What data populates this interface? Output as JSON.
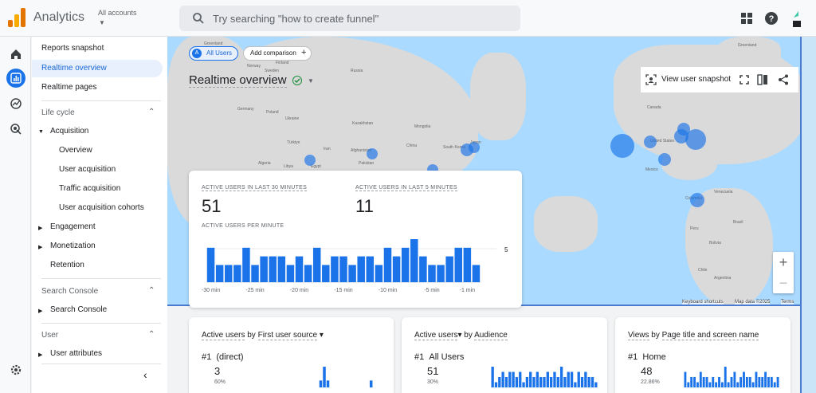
{
  "app": {
    "title": "Analytics",
    "account_label": "All accounts"
  },
  "search": {
    "placeholder": "Try searching \"how to create funnel\""
  },
  "nav": {
    "reports_snapshot": "Reports snapshot",
    "realtime_overview": "Realtime overview",
    "realtime_pages": "Realtime pages",
    "lifecycle": "Life cycle",
    "acquisition": "Acquisition",
    "overview": "Overview",
    "user_acquisition": "User acquisition",
    "traffic_acquisition": "Traffic acquisition",
    "user_acquisition_cohorts": "User acquisition cohorts",
    "engagement": "Engagement",
    "monetization": "Monetization",
    "retention": "Retention",
    "search_console_section": "Search Console",
    "search_console_item": "Search Console",
    "user_section": "User",
    "user_attributes": "User attributes"
  },
  "comparison": {
    "segment_badge": "A",
    "segment": "All Users",
    "add": "Add comparison",
    "plus": "+"
  },
  "page": {
    "title": "Realtime overview",
    "view_user_snapshot": "View user snapshot"
  },
  "map": {
    "labels": [
      "Greenland",
      "Norway",
      "Sweden",
      "Finland",
      "Russia",
      "Germany",
      "Poland",
      "Ukraine",
      "Kazakhstan",
      "Mongolia",
      "Türkiye",
      "Iran",
      "Afghanistan",
      "China",
      "South Korea",
      "Japan",
      "Algeria",
      "Libya",
      "Egypt",
      "Pakistan",
      "Canada",
      "United States",
      "Mexico",
      "Colombia",
      "Peru",
      "Brazil",
      "Bolivia",
      "Chile",
      "Argentina",
      "Venezuela",
      "Greenland"
    ],
    "footer_shortcuts": "Keyboard shortcuts",
    "footer_data": "Map data ©2025",
    "footer_terms": "Terms",
    "zoom_in": "+",
    "zoom_out": "−"
  },
  "realtime_card": {
    "active_30_label": "ACTIVE USERS IN LAST 30 MINUTES",
    "active_30_value": "51",
    "active_5_label": "ACTIVE USERS IN LAST 5 MINUTES",
    "active_5_value": "11",
    "per_minute_label": "ACTIVE USERS PER MINUTE"
  },
  "chart_data": {
    "type": "bar",
    "title": "ACTIVE USERS PER MINUTE",
    "values": [
      4,
      2,
      2,
      2,
      4,
      2,
      3,
      3,
      3,
      2,
      3,
      2,
      4,
      2,
      3,
      3,
      2,
      3,
      3,
      2,
      4,
      3,
      4,
      5,
      3,
      2,
      2,
      3,
      4,
      4,
      2
    ],
    "ylim": [
      0,
      5
    ],
    "y_tick": "5",
    "x_tick_labels": [
      "-30 min",
      "-25 min",
      "-20 min",
      "-15 min",
      "-10 min",
      "-5 min",
      "-1 min"
    ]
  },
  "cards": [
    {
      "title_metric": "Active users",
      "title_by": " by ",
      "title_dim": "First user source",
      "rank": "#1",
      "name": "(direct)",
      "value": "3",
      "pct": "60%",
      "spark": [
        0,
        0,
        0,
        0,
        0,
        0,
        0,
        0,
        0,
        0,
        0,
        0,
        0,
        0,
        1,
        3,
        1,
        0,
        0,
        0,
        0,
        0,
        0,
        0,
        0,
        0,
        0,
        0,
        1,
        0,
        0
      ]
    },
    {
      "title_metric": "Active users",
      "title_by": " by ",
      "title_dim": "Audience",
      "rank": "#1",
      "name": "All Users",
      "value": "51",
      "pct": "30%",
      "spark": [
        4,
        1,
        2,
        3,
        2,
        3,
        3,
        2,
        3,
        1,
        2,
        3,
        2,
        3,
        2,
        2,
        3,
        2,
        3,
        2,
        4,
        2,
        3,
        3,
        1,
        3,
        2,
        3,
        2,
        2,
        1
      ]
    },
    {
      "title_metric": "Views",
      "title_by": " by ",
      "title_dim": "Page title and screen name",
      "rank": "#1",
      "name": "Home",
      "value": "48",
      "pct": "22.86%",
      "spark": [
        3,
        1,
        2,
        2,
        1,
        3,
        2,
        2,
        1,
        2,
        1,
        2,
        1,
        4,
        1,
        2,
        3,
        1,
        2,
        3,
        2,
        2,
        1,
        3,
        2,
        2,
        3,
        2,
        2,
        1,
        2
      ]
    }
  ],
  "colors": {
    "accent": "#1a73e8",
    "bar": "#1a73e8",
    "selected_bg": "#e8f0fe"
  }
}
